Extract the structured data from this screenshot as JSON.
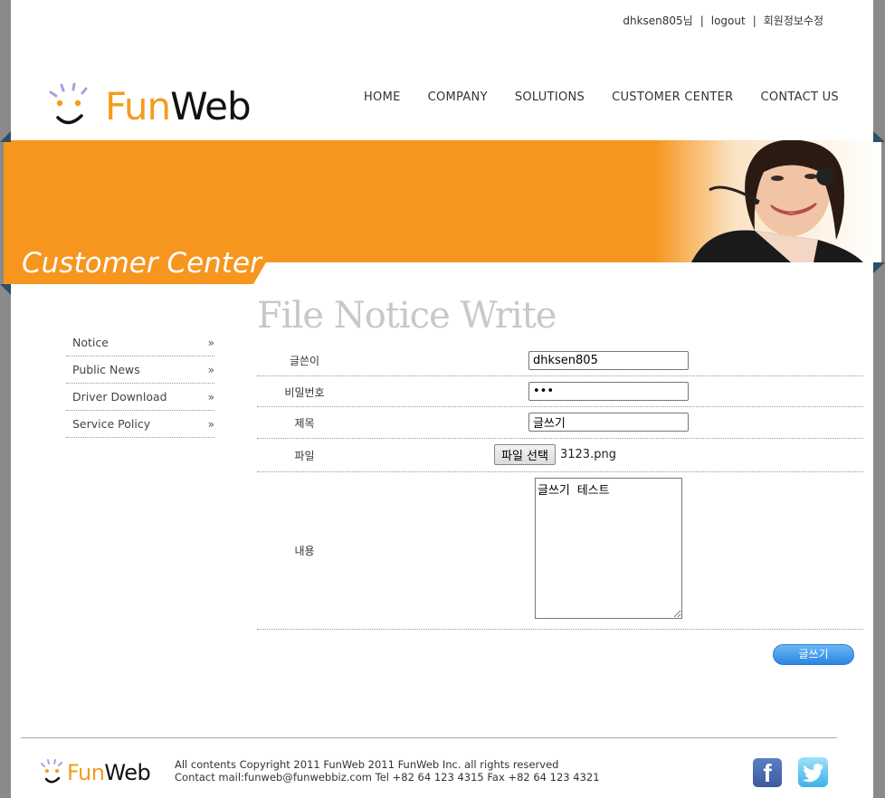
{
  "topbar": {
    "user": "dhksen805님",
    "logout": "logout",
    "edit_profile": "회원정보수정",
    "separator": "|"
  },
  "logo": {
    "fun": "Fun",
    "web": "Web"
  },
  "nav": [
    "HOME",
    "COMPANY",
    "SOLUTIONS",
    "CUSTOMER CENTER",
    "CONTACT US"
  ],
  "banner": {
    "title": "Customer Center",
    "color": "#f6961f"
  },
  "sidebar": {
    "items": [
      {
        "label": "Notice",
        "arrow": "»"
      },
      {
        "label": "Public News",
        "arrow": "»"
      },
      {
        "label": "Driver Download",
        "arrow": "»"
      },
      {
        "label": "Service Policy",
        "arrow": "»"
      }
    ]
  },
  "heading": "File Notice Write",
  "form": {
    "writer_label": "글쓴이",
    "writer_value": "dhksen805",
    "password_label": "비밀번호",
    "password_value": "•••",
    "subject_label": "제목",
    "subject_value": "글쓰기",
    "file_label": "파일",
    "file_button": "파일 선택",
    "file_name": "3123.png",
    "content_label": "내용",
    "content_value": "글쓰기 테스트",
    "submit": "글쓰기"
  },
  "footer": {
    "logo_fun": "Fun",
    "logo_web": "Web",
    "copyright": "All contents Copyright 2011 FunWeb 2011 FunWeb Inc. all rights reserved",
    "contact": "Contact mail:funweb@funwebbiz.com Tel +82 64 123 4315 Fax +82 64 123 4321",
    "facebook_icon": "facebook-icon",
    "twitter_icon": "twitter-icon"
  }
}
